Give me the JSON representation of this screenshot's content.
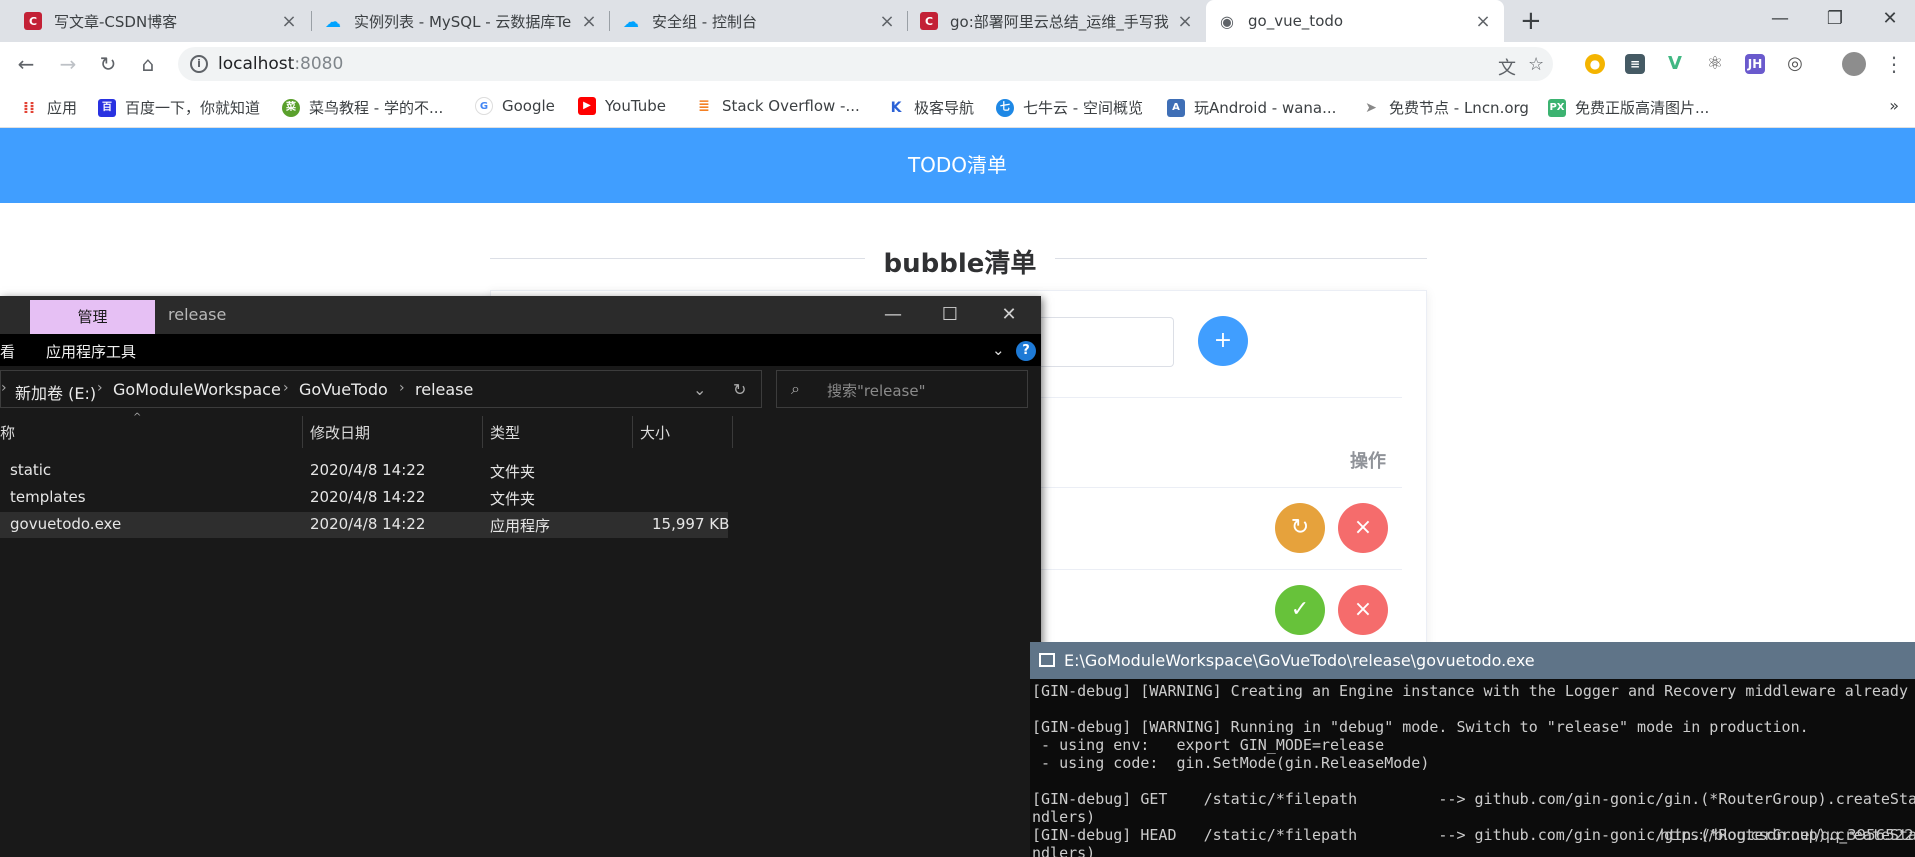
{
  "browser": {
    "tabs": [
      {
        "title": "写文章-CSDN博客",
        "favicon": "C",
        "color": "#c32136"
      },
      {
        "title": "实例列表 - MySQL - 云数据库Te",
        "favicon": "☁",
        "color": "#00a3ff"
      },
      {
        "title": "安全组 - 控制台",
        "favicon": "☁",
        "color": "#00a3ff"
      },
      {
        "title": "go:部署阿里云总结_运维_手写我",
        "favicon": "C",
        "color": "#c32136"
      },
      {
        "title": "go_vue_todo",
        "favicon": "◉",
        "color": "#5f6368"
      }
    ],
    "new_tab": "+",
    "address": {
      "host": "localhost",
      "port": ":8080"
    },
    "bookmarks": [
      {
        "label": "应用",
        "color": "#e34234"
      },
      {
        "label": "百度一下，你就知道",
        "color": "#2932e1"
      },
      {
        "label": "菜鸟教程 - 学的不...",
        "color": "#5aa02c"
      },
      {
        "label": "Google",
        "color": "#4285f4"
      },
      {
        "label": "YouTube",
        "color": "#ff0000"
      },
      {
        "label": "Stack Overflow -...",
        "color": "#f48024"
      },
      {
        "label": "极客导航",
        "color": "#2c62d6"
      },
      {
        "label": "七牛云 - 空间概览",
        "color": "#1e88e5"
      },
      {
        "label": "玩Android - wana...",
        "color": "#3f6fb6"
      },
      {
        "label": "免费节点 - Lncn.org",
        "color": "#999999"
      },
      {
        "label": "免费正版高清图片...",
        "color": "#3cb371"
      }
    ],
    "bookmarks_more": "»"
  },
  "page": {
    "header": "TODO清单",
    "title": "bubble清单",
    "ops_label": "操作",
    "add_button": "+",
    "undo_button": "↻",
    "delete_button": "×",
    "done_button": "✓",
    "accent": "#409eff",
    "watermark": "https://blog.csdn.net/qq_39565226"
  },
  "explorer": {
    "manage_tab": "管理",
    "window_name": "release",
    "ribbon_left": "看",
    "ribbon_app_tools": "应用程序工具",
    "help": "?",
    "breadcrumbs": [
      "新加卷 (E:)",
      "GoModuleWorkspace",
      "GoVueTodo",
      "release"
    ],
    "search_placeholder": "搜索\"release\"",
    "columns": [
      "称",
      "修改日期",
      "类型",
      "大小"
    ],
    "rows": [
      {
        "name": "static",
        "date": "2020/4/8 14:22",
        "type": "文件夹",
        "size": ""
      },
      {
        "name": "templates",
        "date": "2020/4/8 14:22",
        "type": "文件夹",
        "size": ""
      },
      {
        "name": "govuetodo.exe",
        "date": "2020/4/8 14:22",
        "type": "应用程序",
        "size": "15,997 KB"
      }
    ]
  },
  "console": {
    "title": "E:\\GoModuleWorkspace\\GoVueTodo\\release\\govuetodo.exe",
    "lines": [
      "[GIN-debug] [WARNING] Creating an Engine instance with the Logger and Recovery middleware already a",
      "",
      "[GIN-debug] [WARNING] Running in \"debug\" mode. Switch to \"release\" mode in production.",
      " - using env:   export GIN_MODE=release",
      " - using code:  gin.SetMode(gin.ReleaseMode)",
      "",
      "[GIN-debug] GET    /static/*filepath         --> github.com/gin-gonic/gin.(*RouterGroup).createSta",
      "ndlers)",
      "[GIN-debug] HEAD   /static/*filepath         --> github.com/gin-gonic/gin.(*RouterGroup).createSta",
      "ndlers)"
    ]
  }
}
